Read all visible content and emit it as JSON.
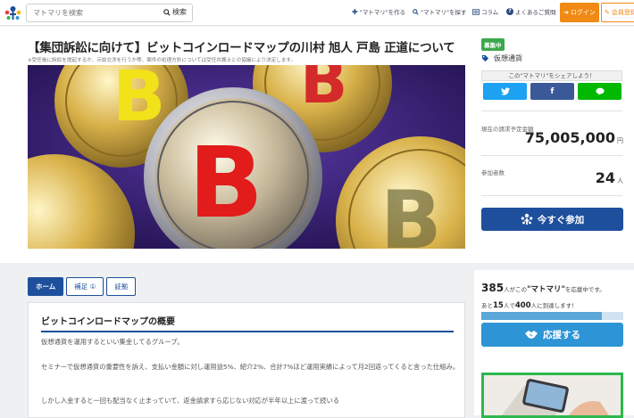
{
  "header": {
    "search_placeholder": "マトマリを検索",
    "search_button": "検索",
    "nav": [
      {
        "icon": "plus-icon",
        "label": "\"マトマリ\"を作る"
      },
      {
        "icon": "search-icon",
        "label": "\"マトマリ\"を探す"
      },
      {
        "icon": "column-icon",
        "label": "コラム"
      },
      {
        "icon": "question-icon",
        "label": "よくあるご質問"
      }
    ],
    "login": "ログイン",
    "register": "会員登録"
  },
  "page": {
    "title": "【集団訴訟に向けて】ビットコインロードマップの川村 旭人 戸島 正道について",
    "note": "※受任後に訴訟を提起するか、示談交渉を行うか等、案件の処理方針については受任弁護士との協議により決定します。"
  },
  "sidebar": {
    "badge": "募集中",
    "category": "仮想通貨",
    "share_label": "この\"マトマリ\"をシェアしよう！",
    "share_buttons": [
      {
        "name": "twitter",
        "color": "#1da1f2"
      },
      {
        "name": "facebook",
        "color": "#3b5998"
      },
      {
        "name": "line",
        "color": "#00b900"
      }
    ],
    "amount_label": "現在の請求予定金額",
    "amount": "75,005,000",
    "amount_unit": "円",
    "participants_label": "参加者数",
    "participants": "24",
    "participants_unit": "人",
    "join_button": "今すぐ参加"
  },
  "tabs": [
    {
      "label": "ホーム",
      "active": true
    },
    {
      "label": "補足 ①",
      "active": false
    },
    {
      "label": "証拠",
      "active": false
    }
  ],
  "content": {
    "section_title": "ビットコインロードマップの概要",
    "paragraphs": [
      "仮想通貨を運用するといい集金してるグループ。",
      "セミナーで仮想通貨の重要性を訴え、支払い金額に対し運用益5%、紹介2%、合計7%ほど運用実績によって月2回返ってくると言った仕組み。",
      "しかし入金すると一回も配当なく止まっていて、返金請求すら応じない対応が半年以上に渡って続いる"
    ]
  },
  "support": {
    "supporters": "385",
    "supporters_text_a": "人がこの",
    "supporters_name": "\"マトマリ\"",
    "supporters_text_b": "を応援中です。",
    "remain_a": "あと",
    "remain_n": "15",
    "remain_b": "人で",
    "remain_goal": "400",
    "remain_c": "人に到達します!",
    "progress": 0.85,
    "support_button": "応援する"
  }
}
